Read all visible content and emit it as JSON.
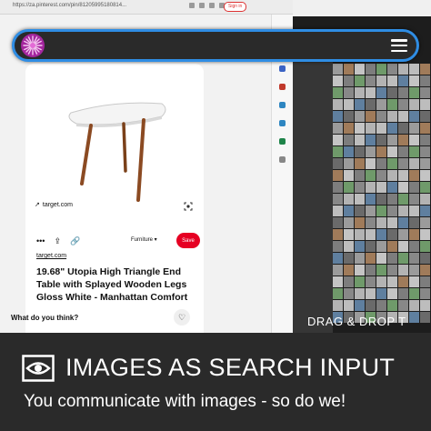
{
  "browser": {
    "url": "https://za.pinterest.com/pin/81205995180814...",
    "sign_in_label": "Sign in"
  },
  "pin": {
    "source_chip": "target.com",
    "board_select": "Furniture",
    "save_label": "Save",
    "source_link": "target.com",
    "title": "19.68\" Utopia High Triangle End Table with Splayed Wooden Legs Gloss White - Manhattan Comfort",
    "comment_prompt": "What do you think?"
  },
  "icons": {
    "more": "more-icon",
    "share": "share-icon",
    "link": "link-icon",
    "lens": "lens-icon",
    "heart": "heart-icon",
    "menu": "hamburger-menu-icon",
    "logo": "flower-logo",
    "eye": "eye-icon"
  },
  "overlay": {
    "drag_drop_text": "DRAG & DROP T"
  },
  "banner": {
    "headline": "IMAGES AS SEARCH INPUT",
    "tagline": "You communicate with images - so do we!"
  },
  "colors": {
    "accent_blue": "#2f8de4",
    "save_red": "#e60023",
    "logo_purple": "#a4269e",
    "banner_bg": "#2a2a2a"
  }
}
